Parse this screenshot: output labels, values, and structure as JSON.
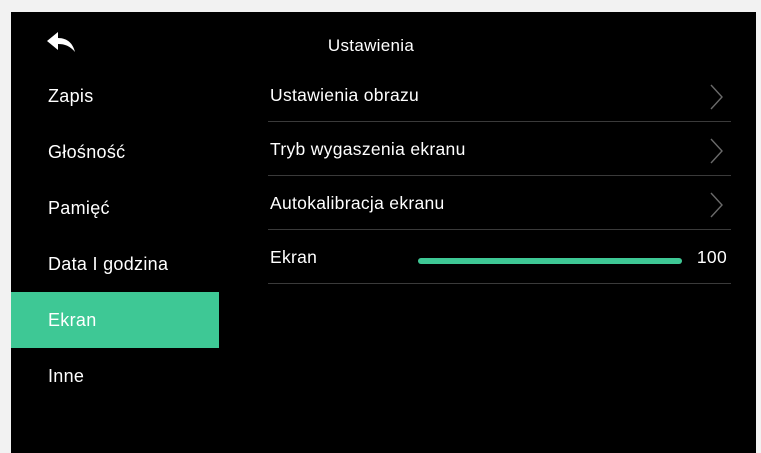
{
  "header": {
    "title": "Ustawienia",
    "back_icon": "back-arrow-icon"
  },
  "sidebar": {
    "items": [
      {
        "label": "Zapis",
        "active": false
      },
      {
        "label": "Głośność",
        "active": false
      },
      {
        "label": "Pamięć",
        "active": false
      },
      {
        "label": "Data I godzina",
        "active": false
      },
      {
        "label": "Ekran",
        "active": true
      },
      {
        "label": "Inne",
        "active": false
      }
    ]
  },
  "content": {
    "rows": [
      {
        "label": "Ustawienia obrazu",
        "icon": "chevron-right-icon"
      },
      {
        "label": "Tryb wygaszenia ekranu",
        "icon": "chevron-right-icon"
      },
      {
        "label": "Autokalibracja ekranu",
        "icon": "chevron-right-icon"
      }
    ],
    "brightness": {
      "label": "Ekran",
      "value": "100",
      "fraction": 1.0
    }
  },
  "colors": {
    "accent": "#3ec895",
    "background": "#000000",
    "text": "#ffffff",
    "divider": "#3a3a3a"
  }
}
